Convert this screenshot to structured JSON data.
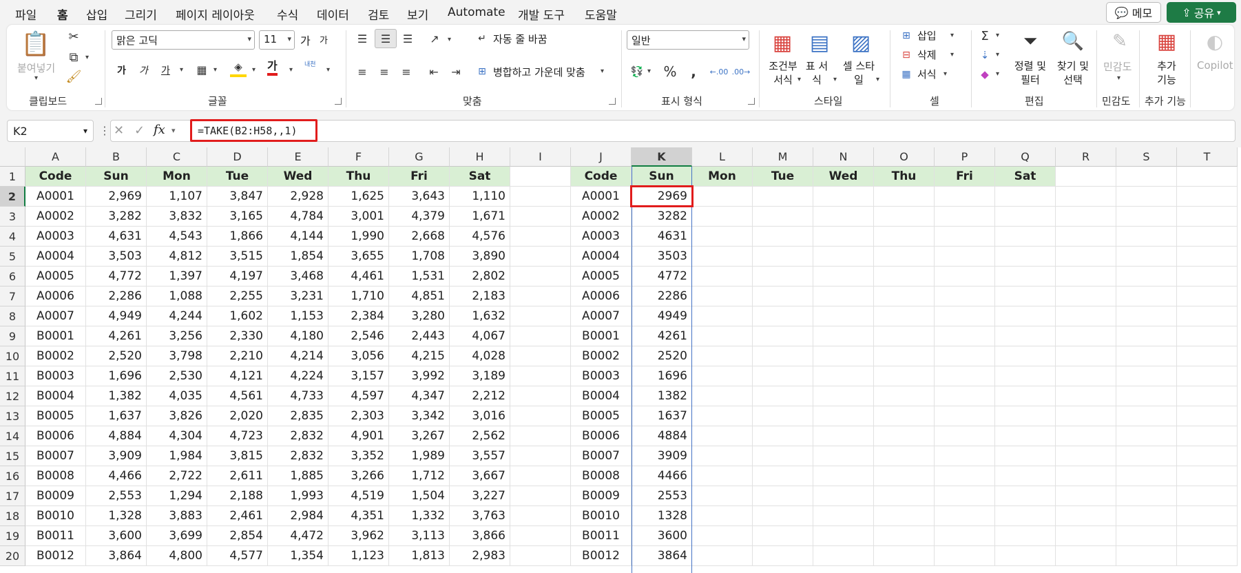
{
  "menu": {
    "tabs": [
      "파일",
      "홈",
      "삽입",
      "그리기",
      "페이지 레이아웃",
      "수식",
      "데이터",
      "검토",
      "보기",
      "Automate",
      "개발 도구",
      "도움말"
    ],
    "active_tab": "홈",
    "memo_label": "메모",
    "share_label": "공유"
  },
  "ribbon": {
    "clipboard": {
      "paste_label": "붙여넣기",
      "group": "클립보드"
    },
    "font": {
      "font_name": "맑은 고딕",
      "font_size": "11",
      "grow": "가",
      "shrink": "가",
      "bold": "가",
      "italic": "가",
      "underline": "가",
      "font_color_glyph": "가",
      "phonetic": "내천",
      "group": "글꼴"
    },
    "align": {
      "wrap_label": "자동 줄 바꿈",
      "merge_label": "병합하고 가운데 맞춤",
      "group": "맞춤"
    },
    "number": {
      "format": "일반",
      "group": "표시 형식"
    },
    "styles": {
      "cond_format": "조건부 서식",
      "table_format": "표 서식",
      "cell_style": "셀 스타일",
      "group": "스타일"
    },
    "cells": {
      "insert": "삽입",
      "delete": "삭제",
      "format": "서식",
      "group": "셀"
    },
    "editing": {
      "sort_filter": "정렬 및 필터",
      "find_select": "찾기 및 선택",
      "group": "편집"
    },
    "sensitivity": {
      "label": "민감도",
      "group": "민감도"
    },
    "addins": {
      "label": "추가 기능",
      "group": "추가 기능"
    },
    "copilot": "Copilot"
  },
  "formula_bar": {
    "name_box": "K2",
    "formula": "=TAKE(B2:H58,,1)"
  },
  "sheet": {
    "columns": [
      "A",
      "B",
      "C",
      "D",
      "E",
      "F",
      "G",
      "H",
      "I",
      "J",
      "K",
      "L",
      "M",
      "N",
      "O",
      "P",
      "Q",
      "R",
      "S",
      "T"
    ],
    "selected_column": "K",
    "selected_row": "2",
    "row_numbers": [
      "1",
      "2",
      "3",
      "4",
      "5",
      "6",
      "7",
      "8",
      "9",
      "10",
      "11",
      "12",
      "13",
      "14",
      "15",
      "16",
      "17",
      "18",
      "19",
      "20"
    ],
    "left_headers": [
      "Code",
      "Sun",
      "Mon",
      "Tue",
      "Wed",
      "Thu",
      "Fri",
      "Sat"
    ],
    "left_rows": [
      [
        "A0001",
        "2,969",
        "1,107",
        "3,847",
        "2,928",
        "1,625",
        "3,643",
        "1,110"
      ],
      [
        "A0002",
        "3,282",
        "3,832",
        "3,165",
        "4,784",
        "3,001",
        "4,379",
        "1,671"
      ],
      [
        "A0003",
        "4,631",
        "4,543",
        "1,866",
        "4,144",
        "1,990",
        "2,668",
        "4,576"
      ],
      [
        "A0004",
        "3,503",
        "4,812",
        "3,515",
        "1,854",
        "3,655",
        "1,708",
        "3,890"
      ],
      [
        "A0005",
        "4,772",
        "1,397",
        "4,197",
        "3,468",
        "4,461",
        "1,531",
        "2,802"
      ],
      [
        "A0006",
        "2,286",
        "1,088",
        "2,255",
        "3,231",
        "1,710",
        "4,851",
        "2,183"
      ],
      [
        "A0007",
        "4,949",
        "4,244",
        "1,602",
        "1,153",
        "2,384",
        "3,280",
        "1,632"
      ],
      [
        "B0001",
        "4,261",
        "3,256",
        "2,330",
        "4,180",
        "2,546",
        "2,443",
        "4,067"
      ],
      [
        "B0002",
        "2,520",
        "3,798",
        "2,210",
        "4,214",
        "3,056",
        "4,215",
        "4,028"
      ],
      [
        "B0003",
        "1,696",
        "2,530",
        "4,121",
        "4,224",
        "3,157",
        "3,992",
        "3,189"
      ],
      [
        "B0004",
        "1,382",
        "4,035",
        "4,561",
        "4,733",
        "4,597",
        "4,347",
        "2,212"
      ],
      [
        "B0005",
        "1,637",
        "3,826",
        "2,020",
        "2,835",
        "2,303",
        "3,342",
        "3,016"
      ],
      [
        "B0006",
        "4,884",
        "4,304",
        "4,723",
        "2,832",
        "4,901",
        "3,267",
        "2,562"
      ],
      [
        "B0007",
        "3,909",
        "1,984",
        "3,815",
        "2,832",
        "3,352",
        "1,989",
        "3,557"
      ],
      [
        "B0008",
        "4,466",
        "2,722",
        "2,611",
        "1,885",
        "3,266",
        "1,712",
        "3,667"
      ],
      [
        "B0009",
        "2,553",
        "1,294",
        "2,188",
        "1,993",
        "4,519",
        "1,504",
        "3,227"
      ],
      [
        "B0010",
        "1,328",
        "3,883",
        "2,461",
        "2,984",
        "4,351",
        "1,332",
        "3,763"
      ],
      [
        "B0011",
        "3,600",
        "3,699",
        "2,854",
        "4,472",
        "3,962",
        "3,113",
        "3,866"
      ],
      [
        "B0012",
        "3,864",
        "4,800",
        "4,577",
        "1,354",
        "1,123",
        "1,813",
        "2,983"
      ]
    ],
    "right_headers": [
      "Code",
      "Sun",
      "Mon",
      "Tue",
      "Wed",
      "Thu",
      "Fri",
      "Sat"
    ],
    "right_codes": [
      "A0001",
      "A0002",
      "A0003",
      "A0004",
      "A0005",
      "A0006",
      "A0007",
      "B0001",
      "B0002",
      "B0003",
      "B0004",
      "B0005",
      "B0006",
      "B0007",
      "B0008",
      "B0009",
      "B0010",
      "B0011",
      "B0012"
    ],
    "right_sun": [
      "2969",
      "3282",
      "4631",
      "3503",
      "4772",
      "2286",
      "4949",
      "4261",
      "2520",
      "1696",
      "1382",
      "1637",
      "4884",
      "3909",
      "4466",
      "2553",
      "1328",
      "3600",
      "3864"
    ]
  },
  "colors": {
    "header_fill": "#d9efd4",
    "highlight": "#e11c1c",
    "accent": "#107c41",
    "spill_border": "#4472c4"
  }
}
